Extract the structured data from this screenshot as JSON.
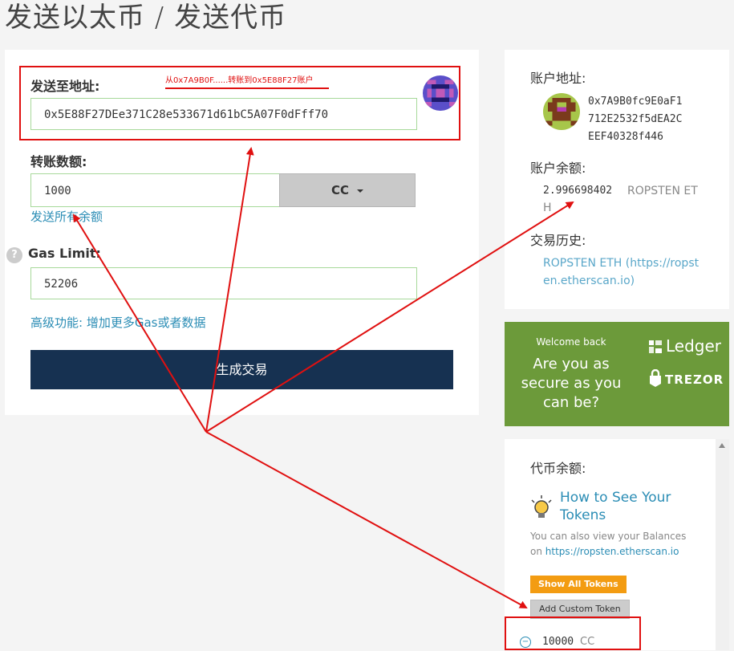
{
  "page": {
    "title": "发送以太币 / 发送代币"
  },
  "send_form": {
    "to_label": "发送至地址:",
    "to_value": "0x5E88F27DEe371C28e533671d61bC5A07F0dFff70",
    "amount_label": "转账数额:",
    "amount_value": "1000",
    "token_select": "CC",
    "send_all": "发送所有余额",
    "gas_label": "Gas Limit:",
    "gas_help": "?",
    "gas_value": "52206",
    "advanced": "高级功能: 增加更多Gas或者数据",
    "generate_button": "生成交易"
  },
  "annotation": {
    "note": "从0x7A9B0F......转账到0x5E88F27账户"
  },
  "account": {
    "address_label": "账户地址:",
    "address_lines": [
      "0x7A9B0fc9E0aF1",
      "712E2532f5dEA2C",
      "EEF40328f446"
    ],
    "balance_label": "账户余额:",
    "balance_value": "2.996698402",
    "balance_unit": "ROPSTEN ET",
    "balance_unit_wrap": "H",
    "history_label": "交易历史:",
    "history_line1": "ROPSTEN ETH (https://ropst",
    "history_line2": "en.etherscan.io)"
  },
  "ledger_ad": {
    "welcome": "Welcome back",
    "line1": "Are you as",
    "line2": "secure as you",
    "line3": "can be?",
    "ledger": "Ledger",
    "trezor": "TREZOR"
  },
  "tokens": {
    "label": "代币余额:",
    "howto_line1": "How to See Your",
    "howto_line2": "Tokens",
    "desc_line1": "You can also view your Balances",
    "desc_prefix": "on ",
    "desc_link": "https://ropsten.etherscan.io",
    "show_all": "Show All Tokens",
    "add_custom": "Add Custom Token",
    "minus": "−",
    "balance_value": "10000",
    "balance_symbol": "CC"
  },
  "colors": {
    "primary_button": "#163151",
    "link": "#2b8db5",
    "ledger_green": "#6c9a3a",
    "annotation_red": "#e01010",
    "orange": "#f39c12"
  }
}
